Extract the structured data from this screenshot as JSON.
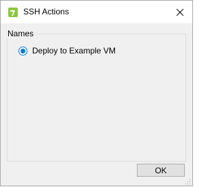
{
  "window": {
    "title": "SSH Actions",
    "icon": "app-logo-icon",
    "close_icon": "close-icon"
  },
  "group": {
    "legend": "Names",
    "options": [
      {
        "label": "Deploy to Example VM",
        "selected": true
      }
    ]
  },
  "footer": {
    "ok_label": "OK"
  },
  "colors": {
    "accent": "#0078d7",
    "icon_green": "#8cc63f",
    "dialog_bg": "#f0f0f0"
  }
}
